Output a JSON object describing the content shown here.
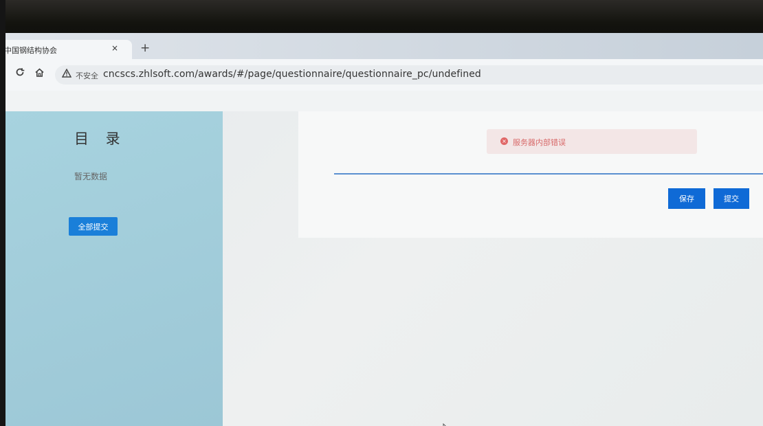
{
  "browser": {
    "tab_title": "中国钢结构协会",
    "tab_close": "×",
    "new_tab": "+",
    "reload_icon": "reload-icon",
    "home_icon": "home-icon",
    "security_label": "不安全",
    "url": "cncscs.zhlsoft.com/awards/#/page/questionnaire/questionnaire_pc/undefined"
  },
  "sidebar": {
    "title": "目 录",
    "empty_text": "暂无数据",
    "submit_all_label": "全部提交"
  },
  "main": {
    "alert_text": "服务器内部错误",
    "save_label": "保存",
    "submit_label": "提交"
  },
  "colors": {
    "sidebar_bg": "#a5d1dd",
    "primary": "#0f6ad6",
    "error": "#e06767"
  }
}
